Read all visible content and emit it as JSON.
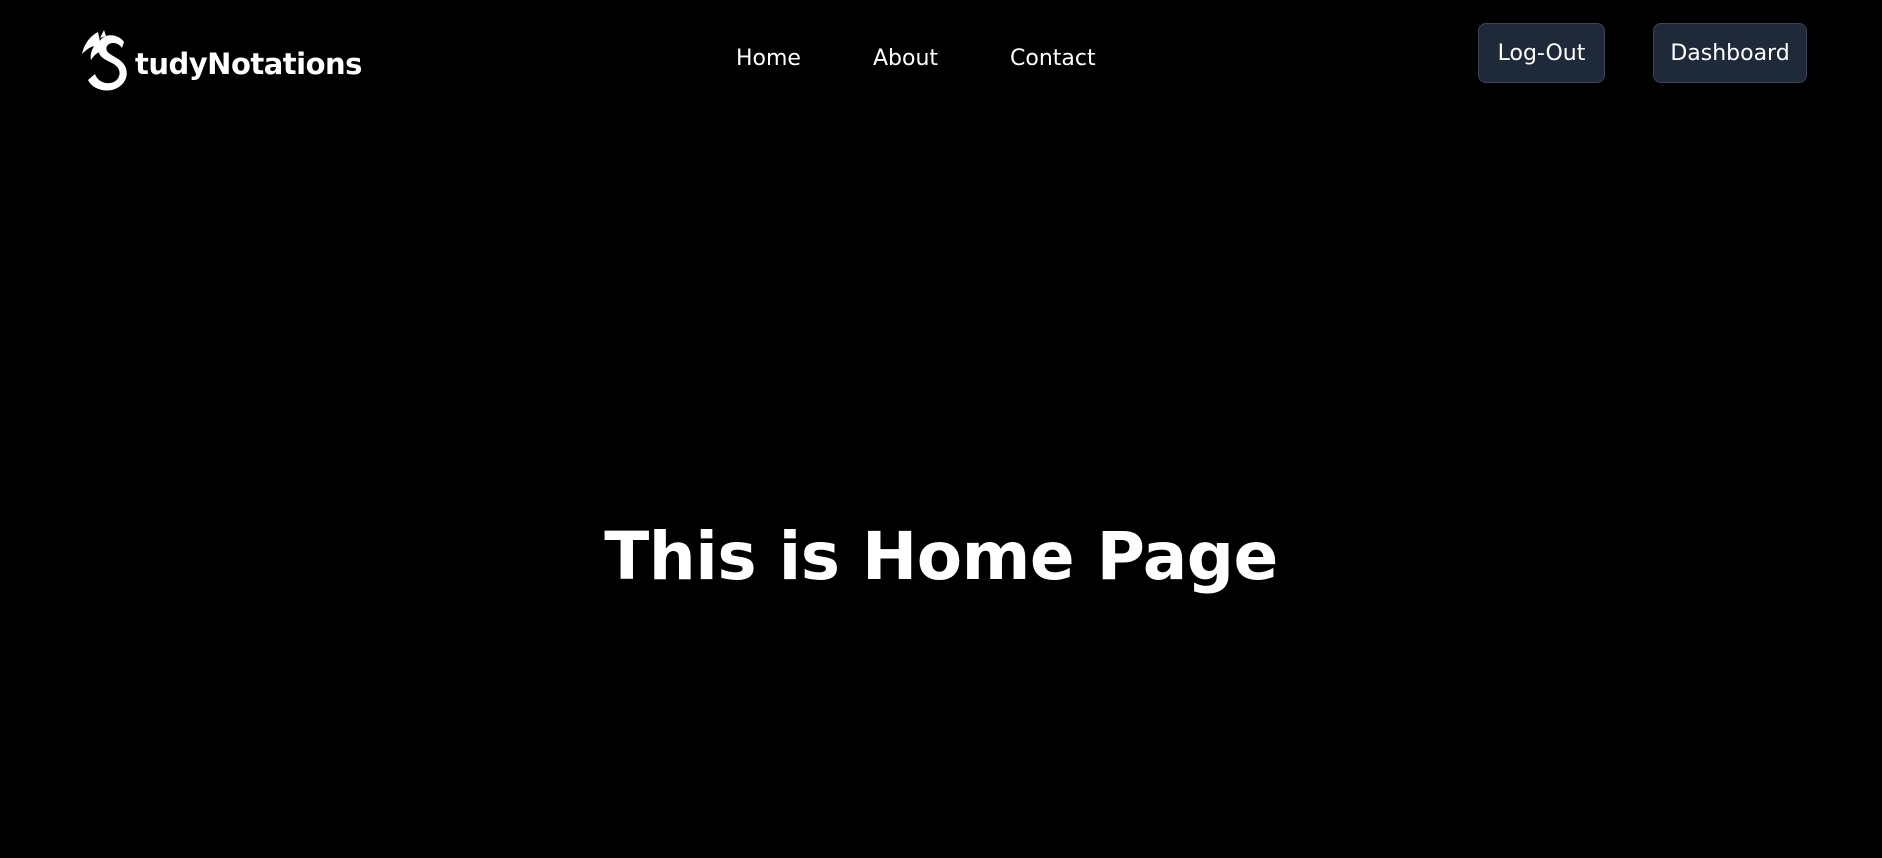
{
  "brand": {
    "logo_icon": "dragon-s-logo-icon",
    "name": "tudyNotations"
  },
  "nav": {
    "links": [
      {
        "label": "Home"
      },
      {
        "label": "About"
      },
      {
        "label": "Contact"
      }
    ]
  },
  "actions": {
    "logout_label": "Log-Out",
    "dashboard_label": "Dashboard"
  },
  "main": {
    "heading": "This is Home Page"
  },
  "colors": {
    "background": "#000000",
    "text": "#ffffff",
    "button_bg": "#1e2939",
    "button_border": "#3a4658"
  }
}
